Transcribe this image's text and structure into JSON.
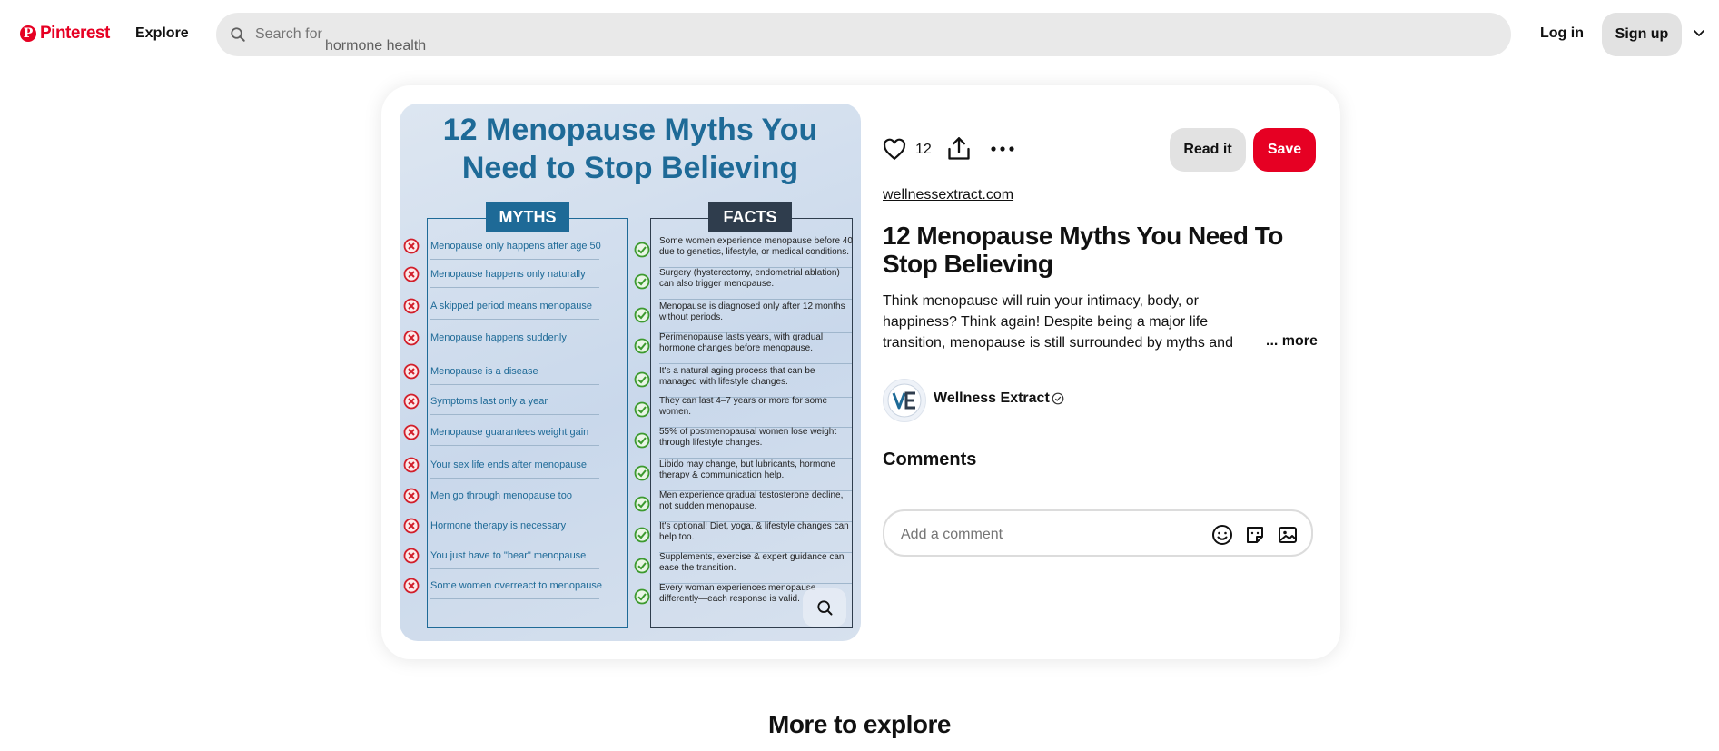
{
  "header": {
    "logo_text": "Pinterest",
    "explore_label": "Explore",
    "search_placeholder": "Search for",
    "search_suggestion": "hormone health",
    "login_label": "Log in",
    "signup_label": "Sign up"
  },
  "pin": {
    "image": {
      "title_line1": "12 Menopause Myths You",
      "title_line2": "Need to Stop Believing",
      "myths_header": "MYTHS",
      "facts_header": "FACTS",
      "myths": [
        "Menopause only happens after age 50",
        "Menopause happens only naturally",
        "A skipped period means menopause",
        "Menopause happens suddenly",
        "Menopause is a disease",
        "Symptoms last only a year",
        "Menopause guarantees weight gain",
        "Your sex life ends after menopause",
        "Men go through menopause too",
        "Hormone therapy is necessary",
        "You just have to \"bear\" menopause",
        "Some women overreact to menopause"
      ],
      "facts": [
        "Some women experience menopause before 40 due to genetics, lifestyle, or medical conditions.",
        "Surgery (hysterectomy, endometrial ablation) can also trigger menopause.",
        "Menopause is diagnosed only after 12 months without periods.",
        "Perimenopause lasts years, with gradual hormone changes before menopause.",
        "It's a natural aging process that can be managed with lifestyle changes.",
        "They can last 4–7 years or more for some women.",
        "55% of postmenopausal women lose weight through lifestyle changes.",
        "Libido may change, but lubricants, hormone therapy & communication help.",
        "Men experience gradual testosterone decline, not sudden menopause.",
        "It's optional! Diet, yoga, & lifestyle changes can help too.",
        "Supplements, exercise & expert guidance can ease the transition.",
        "Every woman experiences menopause differently—each response is valid."
      ]
    },
    "reaction_count": "12",
    "read_it_label": "Read it",
    "save_label": "Save",
    "source": "wellnessextract.com",
    "title": "12 Menopause Myths You Need To Stop Believing",
    "description": "Think menopause will ruin your intimacy, body, or happiness? Think again! Despite being a major life transition, menopause is still surrounded by myths and confusion — even among women themselves.",
    "more_label": "... more",
    "creator": {
      "name": "Wellness Extract",
      "avatar_text": "VE"
    },
    "comments_heading": "Comments",
    "comment_placeholder": "Add a comment"
  },
  "more_to_explore": "More to explore",
  "colors": {
    "brand": "#e60023",
    "myth_blue": "#1e6a97",
    "fact_dark": "#2f3d4d"
  },
  "icons": [
    "pinterest-logo-icon",
    "search-icon",
    "chevron-down-icon",
    "heart-icon",
    "share-icon",
    "more-icon",
    "verified-icon",
    "emoji-icon",
    "sticker-icon",
    "image-icon",
    "visual-search-icon",
    "x-circle-icon",
    "check-circle-icon"
  ]
}
